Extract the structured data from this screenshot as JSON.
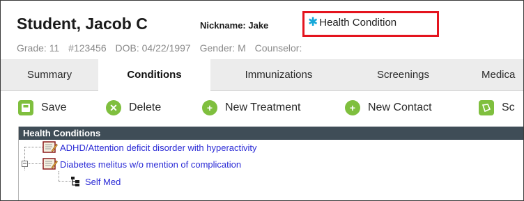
{
  "student": {
    "name": "Student, Jacob C",
    "nickname": "Nickname: Jake",
    "health_flag": "Health Condition",
    "grade": "Grade: 11",
    "id": "#123456",
    "dob": "DOB: 04/22/1997",
    "gender": "Gender: M",
    "counselor": "Counselor:"
  },
  "tabs": [
    {
      "label": "Summary",
      "active": false
    },
    {
      "label": "Conditions",
      "active": true
    },
    {
      "label": "Immunizations",
      "active": false
    },
    {
      "label": "Screenings",
      "active": false
    },
    {
      "label": "Medica",
      "active": false
    }
  ],
  "toolbar": {
    "save": "Save",
    "delete": "Delete",
    "new_treatment": "New Treatment",
    "new_contact": "New Contact",
    "screening": "Sc"
  },
  "tree": {
    "title": "Health Conditions",
    "items": [
      {
        "label": "ADHD/Attention deficit disorder with hyperactivity"
      },
      {
        "label": "Diabetes melitus w/o mention of complication",
        "expanded": true,
        "children": [
          {
            "label": "Self Med"
          }
        ]
      }
    ]
  },
  "colors": {
    "accent_green": "#7fbf3e",
    "highlight_red": "#e4141e",
    "tree_header": "#3f4d57",
    "link_blue": "#2b2bd6",
    "health_icon": "#16a8d9"
  }
}
